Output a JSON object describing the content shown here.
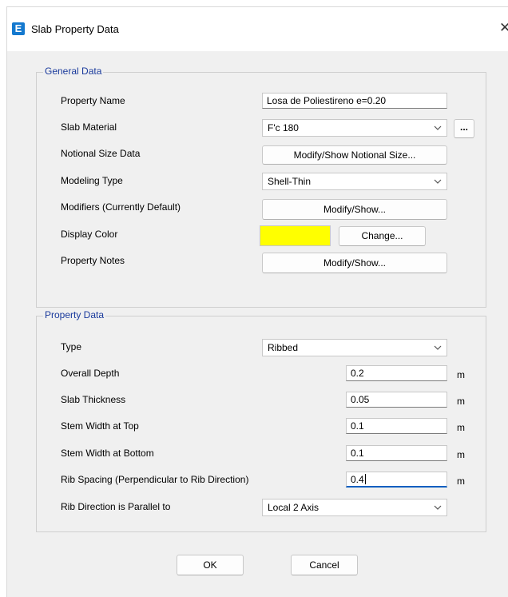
{
  "window": {
    "title": "Slab Property Data",
    "app_icon_letter": "E",
    "close_glyph": "✕"
  },
  "general": {
    "title": "General Data",
    "property_name": {
      "label": "Property Name",
      "value": "Losa de Poliestireno e=0.20"
    },
    "slab_material": {
      "label": "Slab Material",
      "value": "F'c 180",
      "more_label": "..."
    },
    "notional_size": {
      "label": "Notional Size Data",
      "button": "Modify/Show Notional Size..."
    },
    "modeling_type": {
      "label": "Modeling Type",
      "value": "Shell-Thin"
    },
    "modifiers": {
      "label": "Modifiers (Currently Default)",
      "button": "Modify/Show..."
    },
    "display_color": {
      "label": "Display Color",
      "color": "#ffff00",
      "button": "Change..."
    },
    "property_notes": {
      "label": "Property Notes",
      "button": "Modify/Show..."
    }
  },
  "property": {
    "title": "Property Data",
    "type": {
      "label": "Type",
      "value": "Ribbed"
    },
    "overall_depth": {
      "label": "Overall Depth",
      "value": "0.2",
      "unit": "m"
    },
    "slab_thickness": {
      "label": "Slab Thickness",
      "value": "0.05",
      "unit": "m"
    },
    "stem_top": {
      "label": "Stem Width at Top",
      "value": "0.1",
      "unit": "m"
    },
    "stem_bottom": {
      "label": "Stem Width at Bottom",
      "value": "0.1",
      "unit": "m"
    },
    "rib_spacing": {
      "label": "Rib Spacing (Perpendicular to Rib Direction)",
      "value": "0.4",
      "unit": "m"
    },
    "rib_direction": {
      "label": "Rib Direction is Parallel to",
      "value": "Local 2 Axis"
    }
  },
  "buttons": {
    "ok": "OK",
    "cancel": "Cancel"
  }
}
